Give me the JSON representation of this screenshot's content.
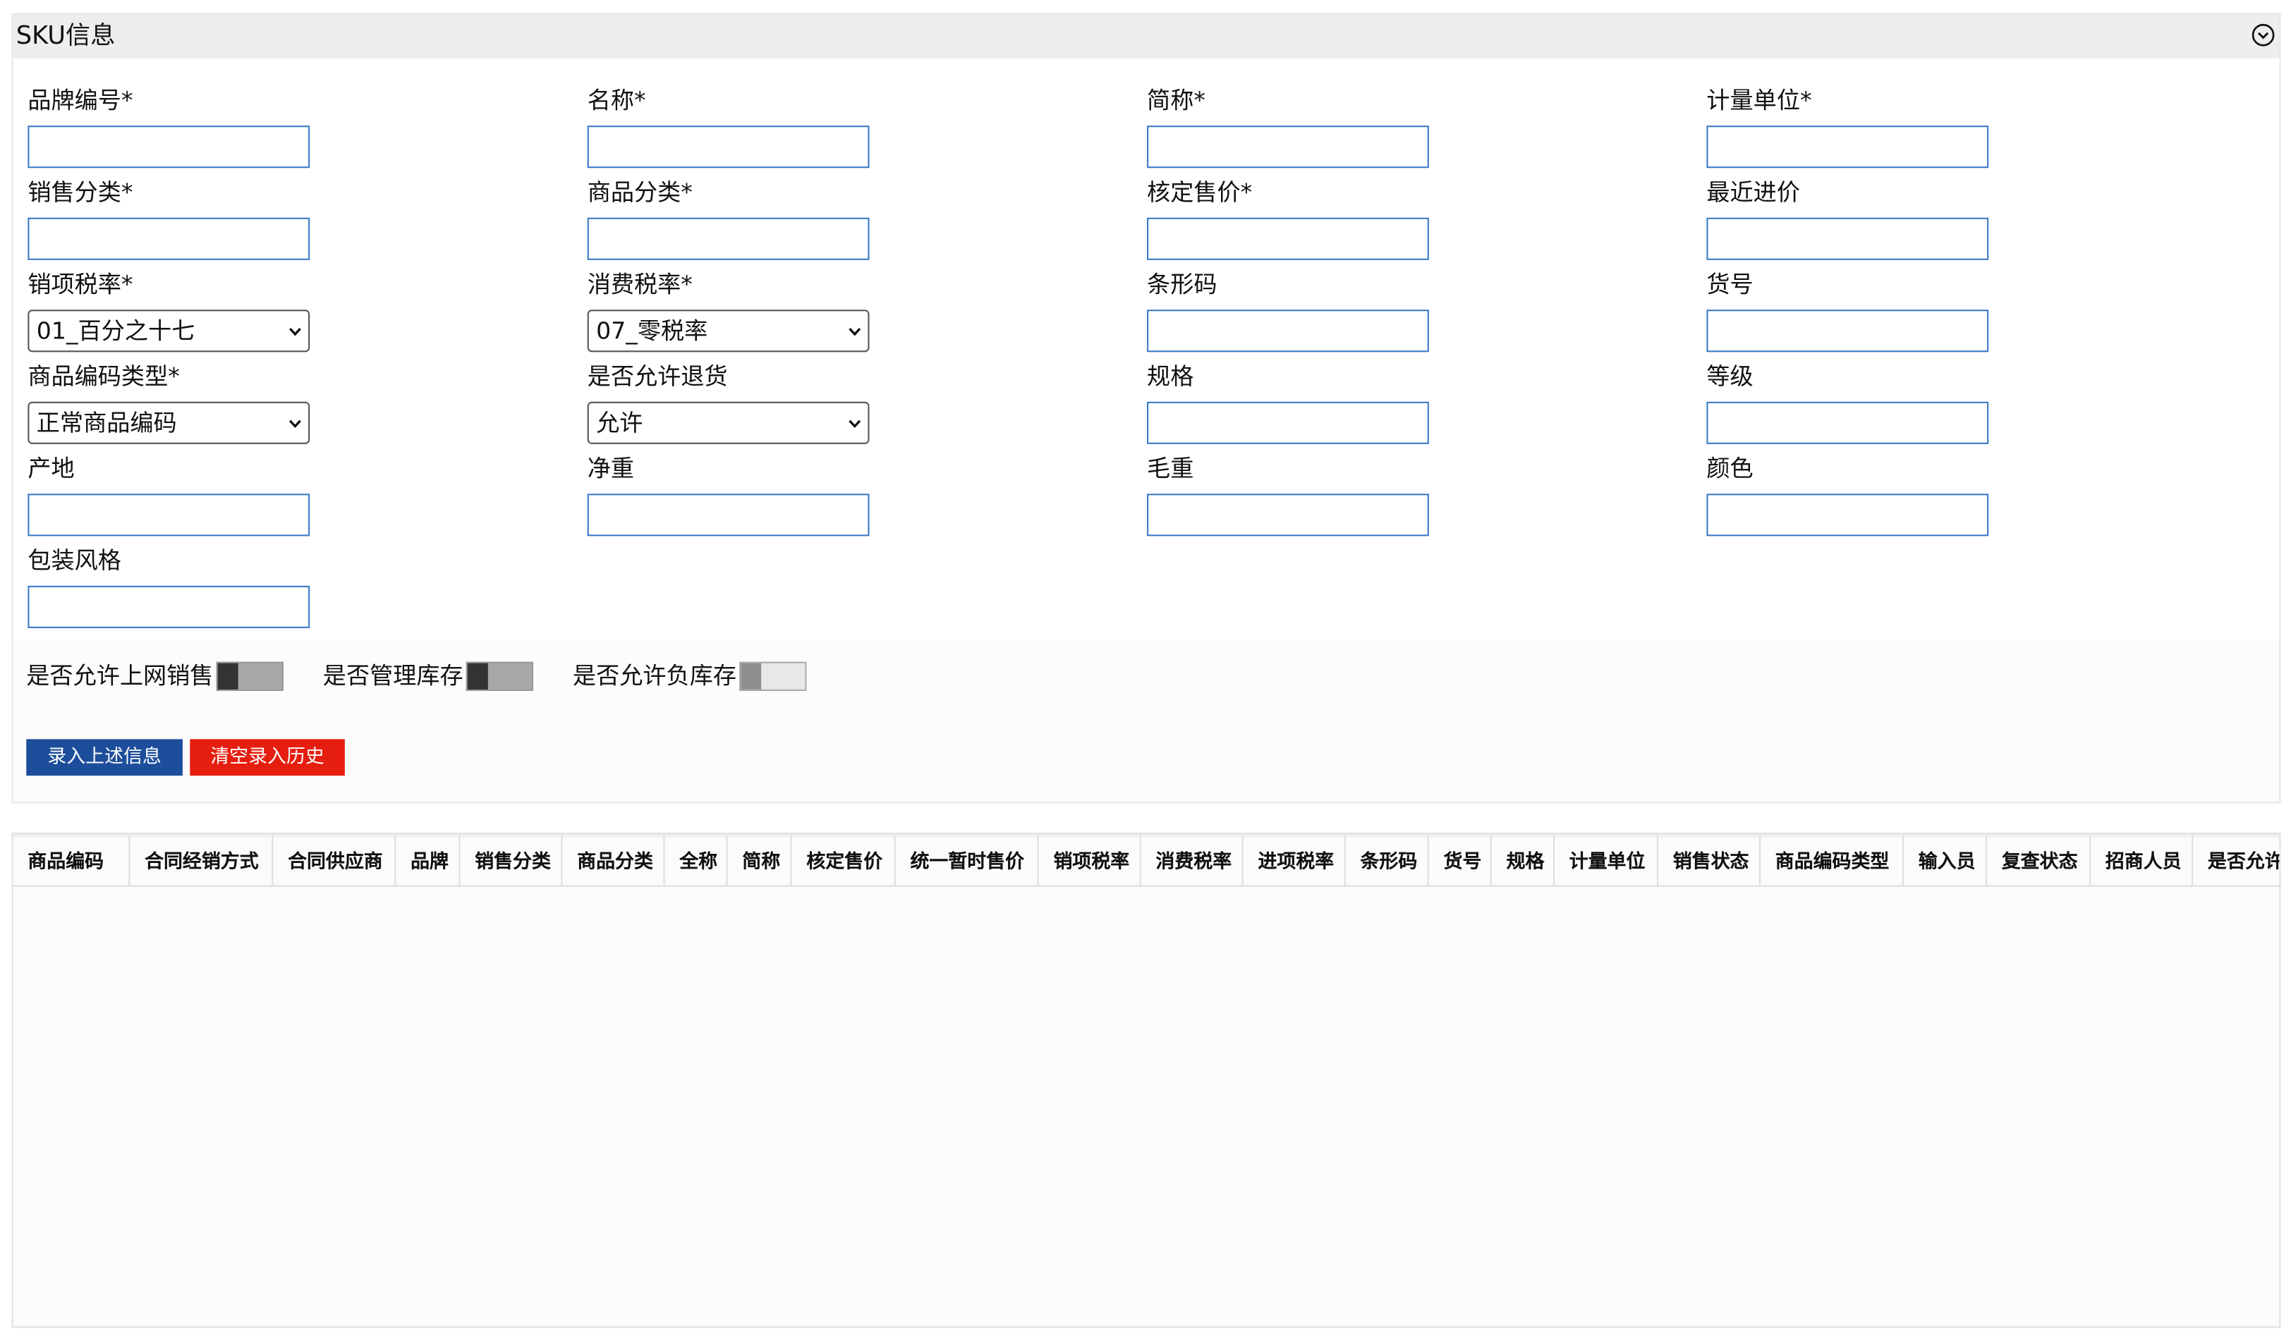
{
  "panel": {
    "title": "SKU信息",
    "collapse_icon": "chevron-down-circle-icon"
  },
  "form": {
    "fields": [
      {
        "label": "品牌编号*",
        "type": "text",
        "value": ""
      },
      {
        "label": "名称*",
        "type": "text",
        "value": ""
      },
      {
        "label": "简称*",
        "type": "text",
        "value": ""
      },
      {
        "label": "计量单位*",
        "type": "text",
        "value": ""
      },
      {
        "label": "销售分类*",
        "type": "text",
        "value": ""
      },
      {
        "label": "商品分类*",
        "type": "text",
        "value": ""
      },
      {
        "label": "核定售价*",
        "type": "text",
        "value": ""
      },
      {
        "label": "最近进价",
        "type": "text",
        "value": ""
      },
      {
        "label": "销项税率*",
        "type": "select",
        "value": "01_百分之十七"
      },
      {
        "label": "消费税率*",
        "type": "select",
        "value": "07_零税率"
      },
      {
        "label": "条形码",
        "type": "text",
        "value": ""
      },
      {
        "label": "货号",
        "type": "text",
        "value": ""
      },
      {
        "label": "商品编码类型*",
        "type": "select",
        "value": "正常商品编码"
      },
      {
        "label": "是否允许退货",
        "type": "select",
        "value": "允许"
      },
      {
        "label": "规格",
        "type": "text",
        "value": ""
      },
      {
        "label": "等级",
        "type": "text",
        "value": ""
      },
      {
        "label": "产地",
        "type": "text",
        "value": ""
      },
      {
        "label": "净重",
        "type": "text",
        "value": ""
      },
      {
        "label": "毛重",
        "type": "text",
        "value": ""
      },
      {
        "label": "颜色",
        "type": "text",
        "value": ""
      },
      {
        "label": "包装风格",
        "type": "text",
        "value": ""
      }
    ]
  },
  "toggles": [
    {
      "label": "是否允许上网销售",
      "on": true
    },
    {
      "label": "是否管理库存",
      "on": true
    },
    {
      "label": "是否允许负库存",
      "on": false
    }
  ],
  "buttons": {
    "submit_label": "录入上述信息",
    "clear_label": "清空录入历史"
  },
  "table": {
    "columns": [
      "商品编码",
      "合同经销方式",
      "合同供应商",
      "品牌",
      "销售分类",
      "商品分类",
      "全称",
      "简称",
      "核定售价",
      "统一暂时售价",
      "销项税率",
      "消费税率",
      "进项税率",
      "条形码",
      "货号",
      "规格",
      "计量单位",
      "销售状态",
      "商品编码类型",
      "输入员",
      "复查状态",
      "招商人员",
      "是否允许"
    ],
    "rows": []
  }
}
